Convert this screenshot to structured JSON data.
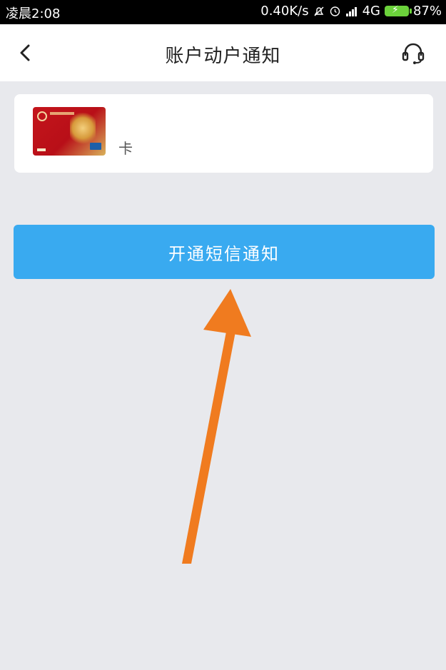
{
  "status_bar": {
    "time": "凌晨2:08",
    "network_speed": "0.40K/s",
    "network_type": "4G",
    "battery": "87%"
  },
  "nav": {
    "title": "账户动户通知",
    "back_icon": "chevron-left-icon",
    "service_icon": "headset-icon"
  },
  "card": {
    "name_text": "卡"
  },
  "actions": {
    "open_sms_label": "开通短信通知"
  },
  "colors": {
    "button": "#39aaf0",
    "background": "#e8e9ed",
    "annotation_arrow": "#f07b1f"
  }
}
